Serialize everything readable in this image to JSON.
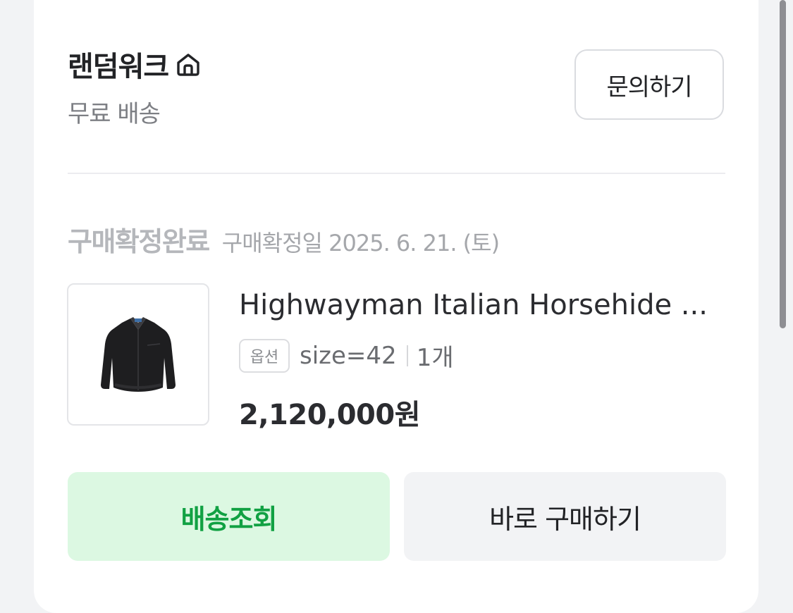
{
  "store": {
    "name": "랜덤워크",
    "icon": "home-icon",
    "shipping": "무료 배송",
    "inquiry_label": "문의하기"
  },
  "order": {
    "status": "구매확정완료",
    "confirm_date": "구매확정일 2025. 6. 21. (토)"
  },
  "product": {
    "name": "Highwayman Italian Horsehide Leather Jacket",
    "option_tag": "옵션",
    "option_value": "size=42",
    "quantity": "1개",
    "price": "2,120,000원"
  },
  "actions": {
    "track_label": "배송조회",
    "buy_label": "바로 구매하기"
  },
  "colors": {
    "track_bg": "#dcf8e2",
    "track_text": "#11a143",
    "buy_bg": "#f2f3f5"
  }
}
